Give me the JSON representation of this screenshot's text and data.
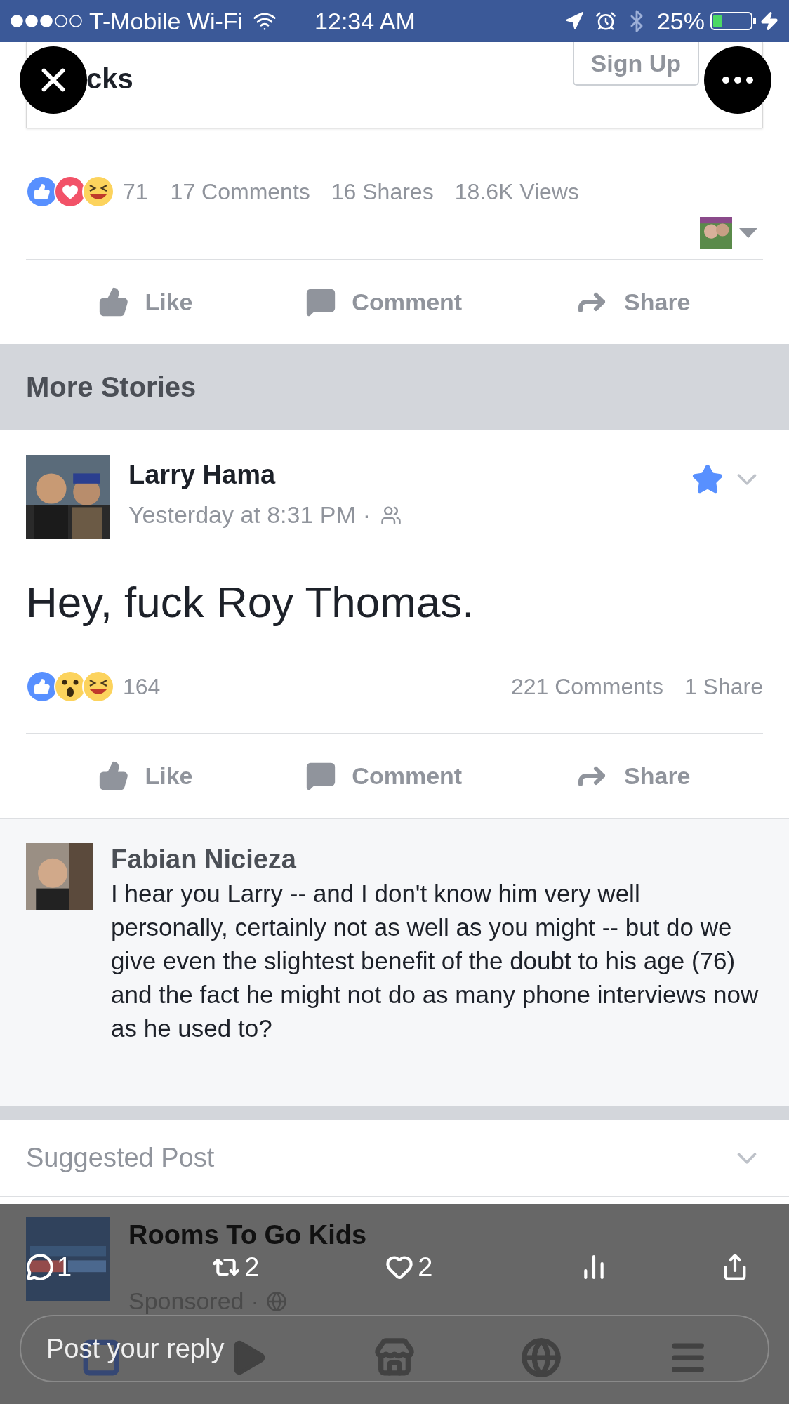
{
  "status_bar": {
    "carrier": "T-Mobile Wi-Fi",
    "time": "12:34 AM",
    "battery": "25%"
  },
  "ad_card": {
    "headline_fragment": "cks",
    "button": "Sign Up"
  },
  "first_post": {
    "reactions": [
      {
        "kind": "like"
      },
      {
        "kind": "love"
      },
      {
        "kind": "haha"
      }
    ],
    "reaction_count": "71",
    "comments": "17 Comments",
    "shares": "16 Shares",
    "views": "18.6K Views",
    "actions": [
      {
        "kind": "like",
        "label": "Like"
      },
      {
        "kind": "comment",
        "label": "Comment"
      },
      {
        "kind": "share",
        "label": "Share"
      }
    ]
  },
  "section_header": "More Stories",
  "story": {
    "author": "Larry Hama",
    "time": "Yesterday at 8:31 PM",
    "separator": "·",
    "starred": true,
    "text": "Hey, fuck Roy Thomas.",
    "reactions": [
      {
        "kind": "like"
      },
      {
        "kind": "wow"
      },
      {
        "kind": "haha"
      }
    ],
    "reaction_count": "164",
    "comments": "221 Comments",
    "shares": "1 Share",
    "actions": [
      {
        "kind": "like",
        "label": "Like"
      },
      {
        "kind": "comment",
        "label": "Comment"
      },
      {
        "kind": "share",
        "label": "Share"
      }
    ]
  },
  "comment": {
    "author": "Fabian Nicieza",
    "text": "I hear you Larry -- and I don't know him very well personally, certainly not as well as you might -- but do we give even the slightest benefit of the doubt to his age (76) and the fact he might not do as many phone interviews now as he used to?"
  },
  "suggested": {
    "label": "Suggested Post",
    "page": "Rooms To Go Kids",
    "sponsored": "Sponsored",
    "separator": "·"
  },
  "reply_overlay": {
    "replies": "1",
    "retweets": "2",
    "likes": "2",
    "placeholder": "Post your reply"
  }
}
